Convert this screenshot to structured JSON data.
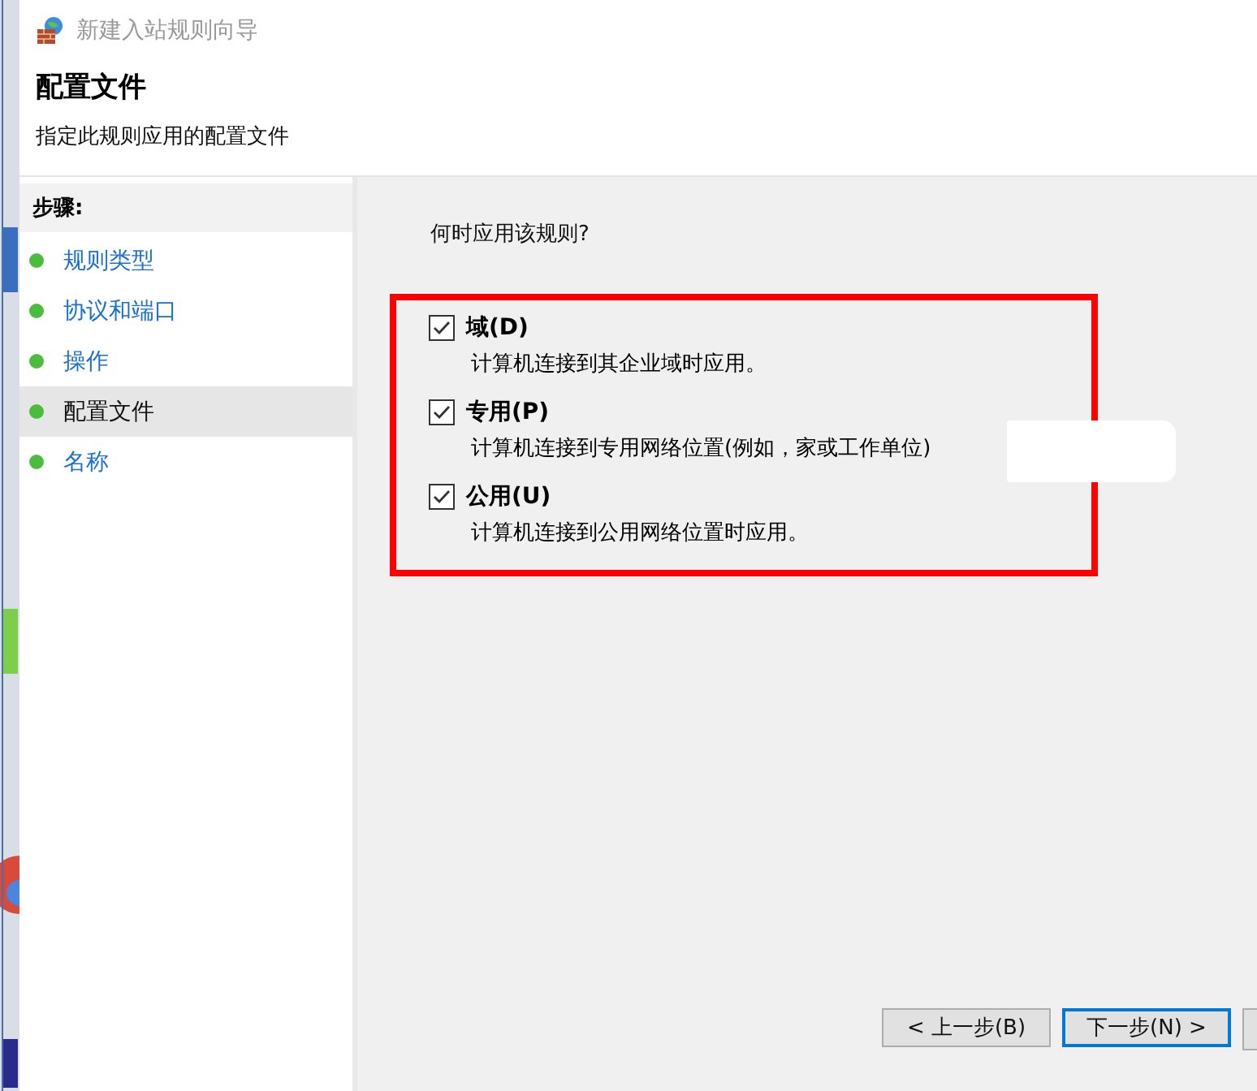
{
  "window": {
    "title": "新建入站规则向导"
  },
  "header": {
    "title": "配置文件",
    "subtitle": "指定此规则应用的配置文件"
  },
  "steps": {
    "heading": "步骤:",
    "items": [
      {
        "label": "规则类型",
        "selected": false
      },
      {
        "label": "协议和端口",
        "selected": false
      },
      {
        "label": "操作",
        "selected": false
      },
      {
        "label": "配置文件",
        "selected": true
      },
      {
        "label": "名称",
        "selected": false
      }
    ]
  },
  "question": "何时应用该规则?",
  "options": [
    {
      "label": "域(D)",
      "description": "计算机连接到其企业域时应用。",
      "checked": true
    },
    {
      "label": "专用(P)",
      "description": "计算机连接到专用网络位置(例如，家或工作单位)",
      "checked": true
    },
    {
      "label": "公用(U)",
      "description": "计算机连接到公用网络位置时应用。",
      "checked": true
    }
  ],
  "buttons": [
    {
      "label": "< 上一步(B)",
      "selected": false
    },
    {
      "label": "下一步(N) >",
      "selected": true
    }
  ]
}
